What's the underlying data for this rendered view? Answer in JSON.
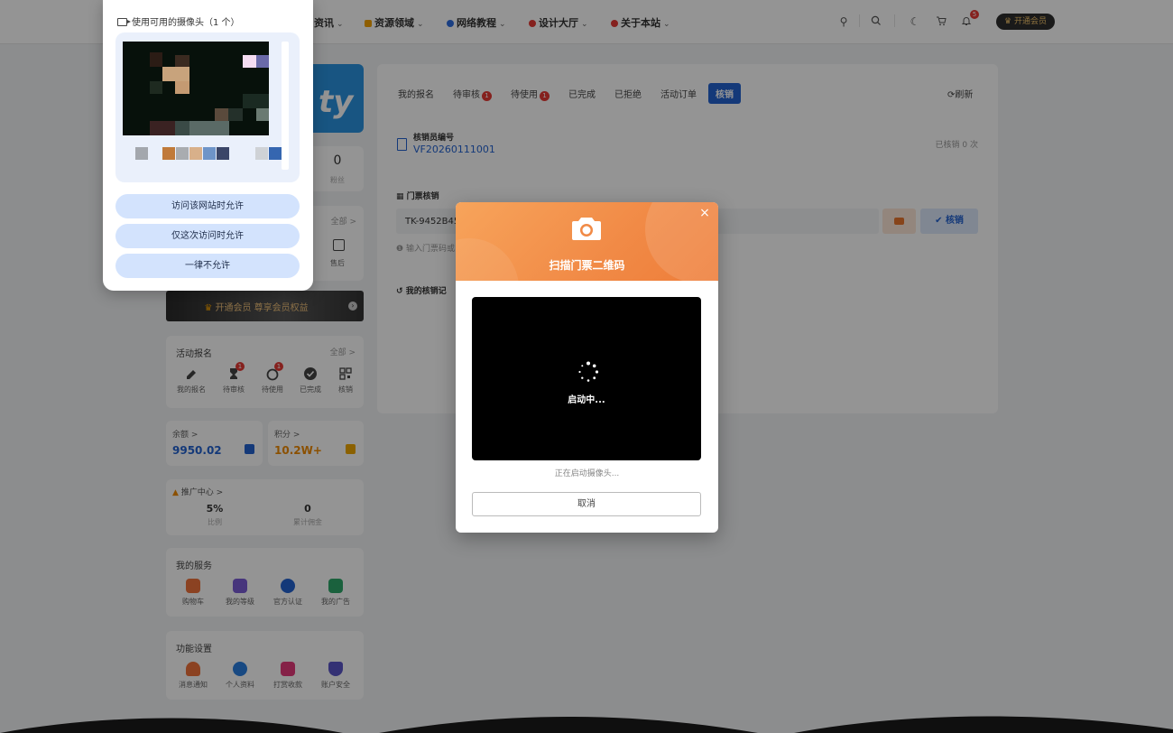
{
  "nav": {
    "items": [
      {
        "label": "资讯",
        "icon": "none",
        "color": "#333333"
      },
      {
        "label": "资源领域",
        "icon": "folder-icon",
        "color": "#f4a300"
      },
      {
        "label": "网络教程",
        "icon": "globe-icon",
        "color": "#2e6de0"
      },
      {
        "label": "设计大厅",
        "icon": "palette-icon",
        "color": "#e53935"
      },
      {
        "label": "关于本站",
        "icon": "info-icon",
        "color": "#e53935"
      }
    ],
    "notify_count": "5",
    "vip_label": "开通会员"
  },
  "sidebar": {
    "stat_value": "0",
    "stat_label": "粉丝",
    "order_more": "全部 >",
    "after_sale_label": "售后",
    "vip_banner": "开通会员 尊享会员权益",
    "activity": {
      "title": "活动报名",
      "more": "全部 >",
      "items": [
        {
          "label": "我的报名",
          "badge": ""
        },
        {
          "label": "待审核",
          "badge": "1"
        },
        {
          "label": "待使用",
          "badge": "1"
        },
        {
          "label": "已完成",
          "badge": ""
        },
        {
          "label": "核销",
          "badge": ""
        }
      ]
    },
    "balance_label": "余额 >",
    "balance_value": "9950.02",
    "points_label": "积分 >",
    "points_value": "10.2W+",
    "promo": {
      "title": "推广中心 >",
      "ratio_value": "5%",
      "ratio_label": "比例",
      "commission_value": "0",
      "commission_label": "累计佣金"
    },
    "services": {
      "title": "我的服务",
      "items": [
        "购物车",
        "我的等级",
        "官方认证",
        "我的广告"
      ]
    },
    "settings": {
      "title": "功能设置",
      "items": [
        "消息通知",
        "个人资料",
        "打赏收款",
        "账户安全"
      ]
    }
  },
  "main": {
    "tabs": [
      {
        "label": "我的报名",
        "badge": ""
      },
      {
        "label": "待审核",
        "badge": "1"
      },
      {
        "label": "待使用",
        "badge": "1"
      },
      {
        "label": "已完成",
        "badge": ""
      },
      {
        "label": "已拒绝",
        "badge": ""
      },
      {
        "label": "活动订单",
        "badge": ""
      },
      {
        "label": "核销",
        "badge": ""
      }
    ],
    "refresh_label": "刷新",
    "verifier_label": "核销员编号",
    "verifier_id": "VF20260111001",
    "verified_count": "已核销 0 次",
    "ticket_section": "门票核销",
    "ticket_input_value": "TK-9452B45",
    "ticket_hint": "输入门票码或",
    "verify_button": "核销",
    "records_title": "我的核销记"
  },
  "modal": {
    "title": "扫描门票二维码",
    "video_label": "启动中...",
    "status": "正在启动摄像头...",
    "cancel_label": "取消"
  },
  "permission": {
    "header": "使用可用的摄像头（1 个）",
    "buttons": [
      "访问该网站时允许",
      "仅这次访问时允许",
      "一律不允许"
    ]
  }
}
